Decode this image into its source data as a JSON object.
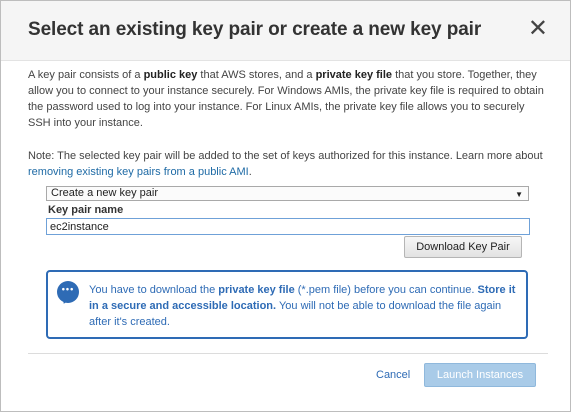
{
  "dialog": {
    "title": "Select an existing key pair or create a new key pair",
    "close_icon": "close-icon"
  },
  "description": {
    "p1_a": "A key pair consists of a ",
    "p1_b": "public key",
    "p1_c": " that AWS stores, and a ",
    "p1_d": "private key file",
    "p1_e": " that you store. Together, they allow you to connect to your instance securely. For Windows AMIs, the private key file is required to obtain the password used to log into your instance. For Linux AMIs, the private key file allows you to securely SSH into your instance.",
    "note_a": "Note: The selected key pair will be added to the set of keys authorized for this instance. Learn more about ",
    "note_link": "removing existing key pairs from a public AMI",
    "note_end": "."
  },
  "key_pair_select": {
    "selected": "Create a new key pair",
    "arrow_icon": "dropdown-arrow-icon"
  },
  "key_pair_name": {
    "label": "Key pair name",
    "value": "ec2instance"
  },
  "download_button": {
    "label": "Download Key Pair"
  },
  "info_box": {
    "icon": "chat-bubble-icon",
    "t1": "You have to download the ",
    "t2": "private key file",
    "t3": " (*.pem file) before you can continue. ",
    "t4": "Store it in a secure and accessible location.",
    "t5": " You will not be able to download the file again after it's created."
  },
  "footer": {
    "cancel_label": "Cancel",
    "launch_label": "Launch Instances"
  },
  "colors": {
    "accent": "#2e6bb5",
    "launch_disabled": "#a9cbe8"
  }
}
